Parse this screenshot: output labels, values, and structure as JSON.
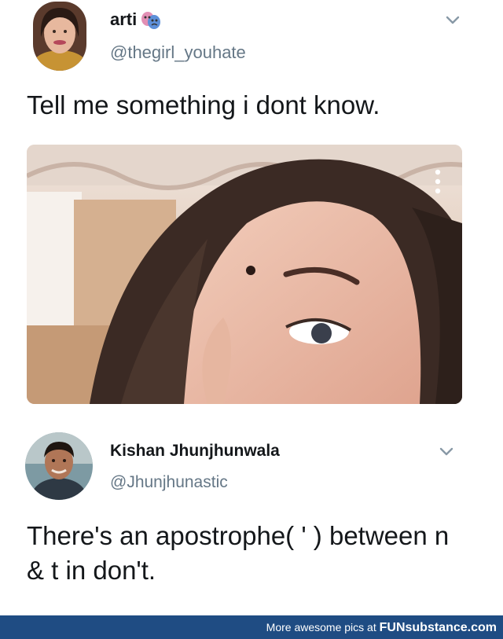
{
  "tweet1": {
    "display_name": "arti",
    "name_emoji_icon": "theater-masks-icon",
    "handle": "@thegirl_youhate",
    "text": "Tell me something i dont know.",
    "media_icon": "more-vertical-icon"
  },
  "tweet2": {
    "display_name": "Kishan Jhunjhunwala",
    "handle": "@Jhunjhunastic",
    "text": "There's an apostrophe( ' ) between n & t in don't."
  },
  "footer": {
    "prefix": "More awesome pics at ",
    "brand": "FUNsubstance.com"
  },
  "colors": {
    "handle": "#657786",
    "text": "#14171a",
    "footer_bg": "#1f4c83"
  }
}
